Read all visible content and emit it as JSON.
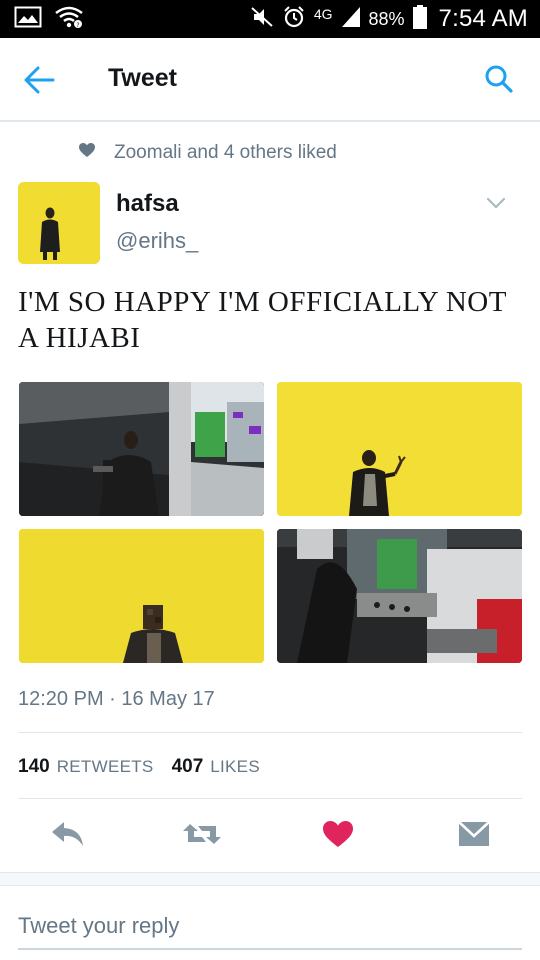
{
  "status_bar": {
    "network": "4G",
    "battery_pct": "88%",
    "time": "7:54 AM",
    "icons": [
      "gallery-icon",
      "wifi-icon",
      "mute-icon",
      "alarm-icon",
      "signal-icon",
      "battery-icon"
    ]
  },
  "header": {
    "title": "Tweet",
    "icons": [
      "back-arrow-icon",
      "search-icon"
    ]
  },
  "social_context": {
    "text": "Zoomali and 4 others liked",
    "icon": "heart-icon"
  },
  "author": {
    "name": "hafsa",
    "handle": "@erihs_"
  },
  "tweet": {
    "text": "I'M SO HAPPY I'M OFFICIALLY NOT A HIJABI",
    "media_count": 4,
    "timestamp": "12:20 PM · 16 May 17"
  },
  "stats": {
    "retweets_count": "140",
    "retweets_label": "RETWEETS",
    "likes_count": "407",
    "likes_label": "LIKES"
  },
  "actions": {
    "icons": [
      "reply-icon",
      "retweet-icon",
      "like-heart-icon",
      "direct-message-icon"
    ],
    "liked": true
  },
  "reply": {
    "placeholder": "Tweet your reply"
  },
  "colors": {
    "accent": "#1da1f2",
    "like": "#e0245e",
    "muted": "#657786",
    "icon_gray": "#8899a6",
    "divider": "#e1e8ed"
  }
}
